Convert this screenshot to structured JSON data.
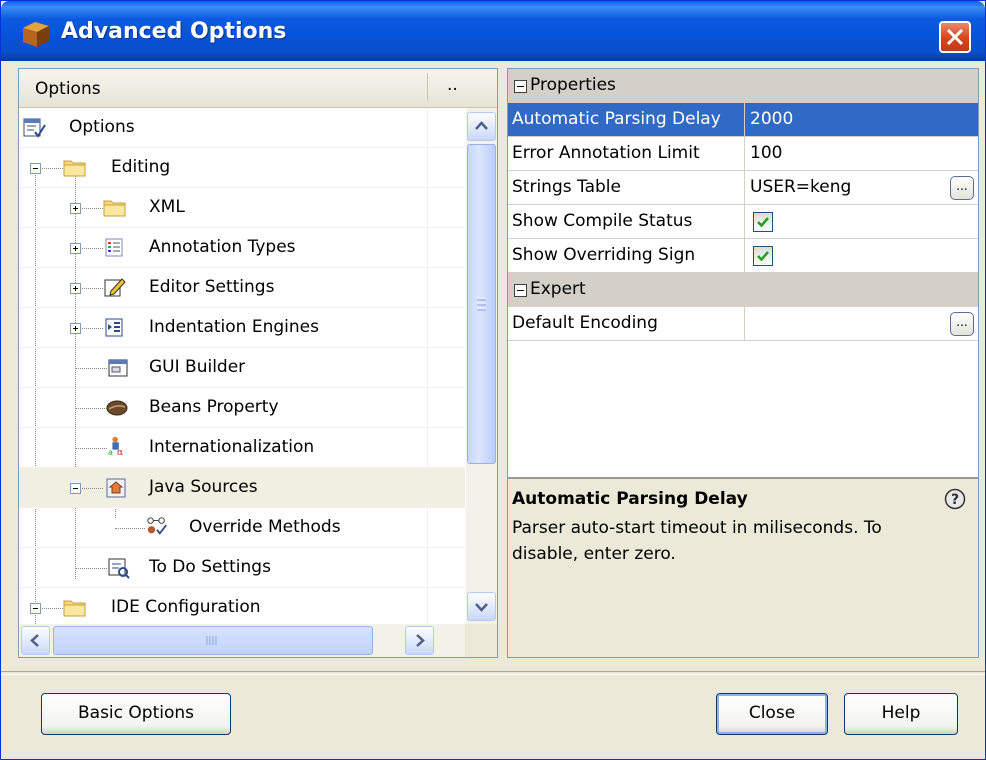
{
  "window": {
    "title": "Advanced Options"
  },
  "tree": {
    "header": {
      "column1": "Options",
      "column2": ".."
    },
    "items": [
      {
        "label": "Options",
        "icon": "options-icon"
      },
      {
        "label": "Editing",
        "icon": "folder-icon"
      },
      {
        "label": "XML",
        "icon": "folder-icon"
      },
      {
        "label": "Annotation Types",
        "icon": "annotation-types-icon"
      },
      {
        "label": "Editor Settings",
        "icon": "editor-settings-icon"
      },
      {
        "label": "Indentation Engines",
        "icon": "indentation-icon"
      },
      {
        "label": "GUI Builder",
        "icon": "gui-builder-icon"
      },
      {
        "label": "Beans Property",
        "icon": "bean-icon"
      },
      {
        "label": "Internationalization",
        "icon": "internationalization-icon"
      },
      {
        "label": "Java Sources",
        "icon": "java-sources-icon"
      },
      {
        "label": "Override Methods",
        "icon": "override-methods-icon"
      },
      {
        "label": "To Do Settings",
        "icon": "todo-settings-icon"
      },
      {
        "label": "IDE Configuration",
        "icon": "folder-icon"
      }
    ]
  },
  "properties": {
    "categories": {
      "properties": "Properties",
      "expert": "Expert"
    },
    "rows": [
      {
        "name": "Automatic Parsing Delay",
        "value": "2000"
      },
      {
        "name": "Error Annotation Limit",
        "value": "100"
      },
      {
        "name": "Strings Table",
        "value": "USER=keng",
        "button": "..."
      },
      {
        "name": "Show Compile Status",
        "checked": true
      },
      {
        "name": "Show Overriding Sign",
        "checked": true
      },
      {
        "name": "Default Encoding",
        "value": "",
        "button": "..."
      }
    ],
    "description": {
      "title": "Automatic Parsing Delay",
      "text": "Parser auto-start timeout in miliseconds. To disable, enter zero."
    }
  },
  "buttons": {
    "basic_options": "Basic Options",
    "close": "Close",
    "help": "Help"
  },
  "colors": {
    "titlebar": "#0653D8",
    "selection": "#316AC5",
    "dialog_bg": "#ECE9D8",
    "close_button": "#D6441C",
    "checkbox_tick": "#21A121"
  }
}
